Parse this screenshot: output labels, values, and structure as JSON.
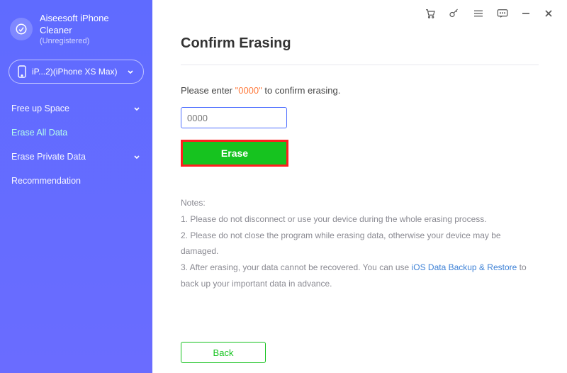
{
  "brand": {
    "title": "Aiseesoft iPhone Cleaner",
    "subtitle": "(Unregistered)"
  },
  "device": {
    "label": "iP...2)(iPhone XS Max)"
  },
  "sidebar": {
    "items": [
      {
        "label": "Free up Space",
        "expandable": true
      },
      {
        "label": "Erase All Data",
        "expandable": false
      },
      {
        "label": "Erase Private Data",
        "expandable": true
      },
      {
        "label": "Recommendation",
        "expandable": false
      }
    ]
  },
  "main": {
    "heading": "Confirm Erasing",
    "prompt_pre": "Please enter ",
    "prompt_code": "\"0000\"",
    "prompt_post": " to confirm erasing.",
    "input_placeholder": "0000",
    "erase_label": "Erase",
    "notes_title": "Notes:",
    "note1": "1. Please do not disconnect or use your device during the whole erasing process.",
    "note2": "2. Please do not close the program while erasing data, otherwise your device may be damaged.",
    "note3_pre": "3. After erasing, your data cannot be recovered. You can use ",
    "note3_link": "iOS Data Backup & Restore",
    "note3_post": " to back up your important data in advance.",
    "back_label": "Back"
  }
}
